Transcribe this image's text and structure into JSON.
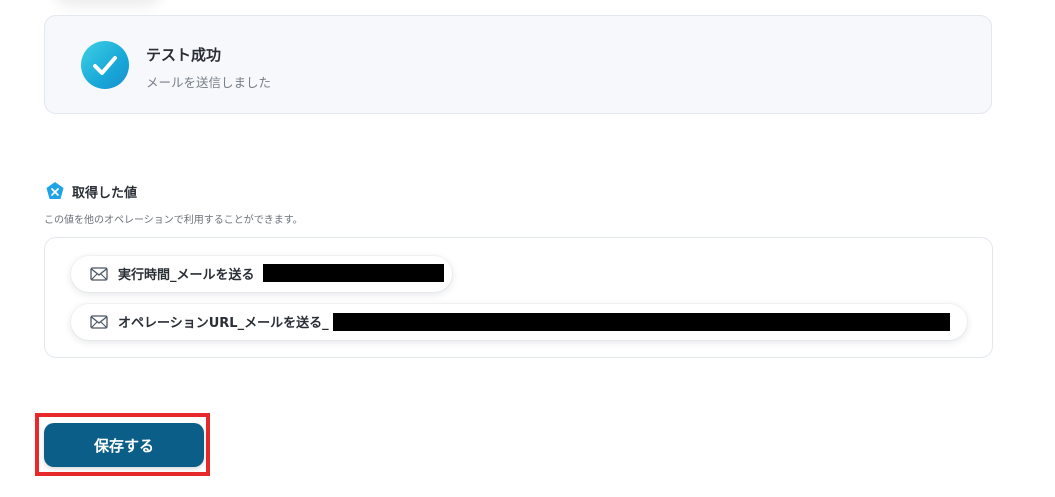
{
  "test_result": {
    "title": "テスト成功",
    "subtitle": "メールを送信しました",
    "icon": "check-circle-icon",
    "accent_color": "#19a8d8"
  },
  "acquired_values": {
    "title": "取得した値",
    "description": "この値を他のオペレーションで利用することができます。",
    "icon": "badge-icon",
    "items": [
      {
        "icon": "mail-icon",
        "label": "実行時間_メールを送る"
      },
      {
        "icon": "mail-icon",
        "label": "オペレーションURL_メールを送る_"
      }
    ]
  },
  "footer": {
    "save_label": "保存する",
    "save_color": "#0b5e87",
    "highlight_color": "#e8292b"
  }
}
